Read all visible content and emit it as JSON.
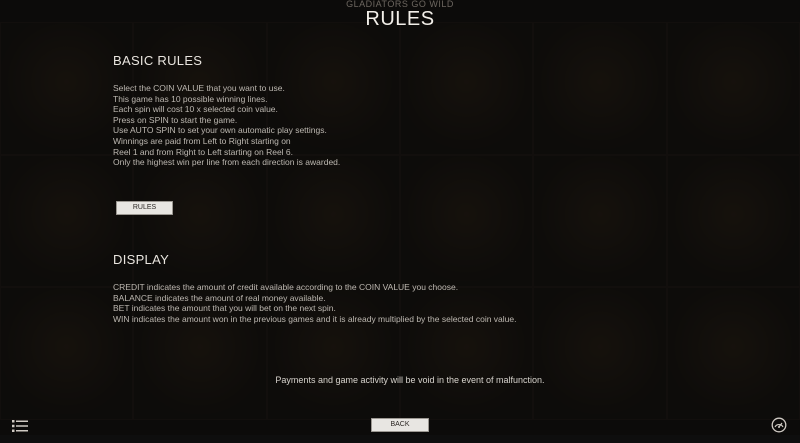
{
  "game": {
    "title": "GLADIATORS GO WILD"
  },
  "page": {
    "title": "RULES"
  },
  "basic_rules": {
    "heading": "BASIC RULES",
    "lines": [
      "Select the COIN VALUE that you want to use.",
      "This game has 10 possible winning lines.",
      "Each spin will cost 10 x selected coin value.",
      "Press on SPIN to start the game.",
      "Use AUTO SPIN to set your own automatic play settings.",
      "Winnings are paid from Left to Right starting on",
      "Reel 1 and from Right to Left starting on Reel 6.",
      "Only the highest win per line from each direction is awarded."
    ],
    "button_label": "RULES"
  },
  "display": {
    "heading": "DISPLAY",
    "lines": [
      "CREDIT indicates the amount of credit available according to the COIN VALUE you choose.",
      "BALANCE indicates the amount of real money available.",
      "BET indicates the amount that you will bet on the next spin.",
      "WIN indicates the amount won in the previous games and it is already multiplied by the selected coin value."
    ]
  },
  "notice": "Payments and game activity will be void in the event of malfunction.",
  "footer": {
    "back_label": "BACK"
  },
  "icons": {
    "menu": "menu-list-icon",
    "settings": "settings-gauge-icon"
  },
  "colors": {
    "background": "#0c0b0a",
    "button": "#e8e6e2",
    "title": "#f2efe9"
  }
}
